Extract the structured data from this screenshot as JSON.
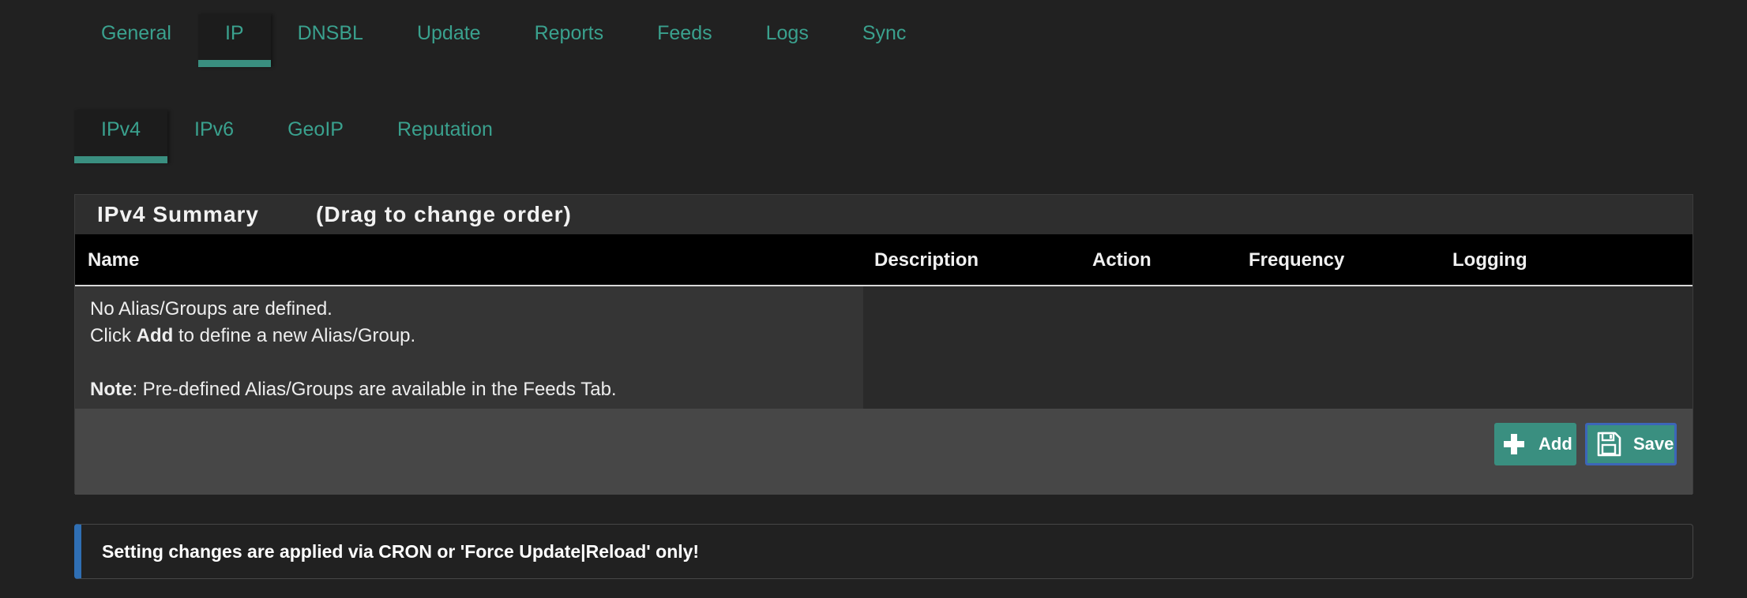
{
  "main_tabs": [
    "General",
    "IP",
    "DNSBL",
    "Update",
    "Reports",
    "Feeds",
    "Logs",
    "Sync"
  ],
  "sub_tabs": [
    "IPv4",
    "IPv6",
    "GeoIP",
    "Reputation"
  ],
  "panel": {
    "title": "IPv4 Summary",
    "subtitle": "(Drag to change order)"
  },
  "table": {
    "columns": [
      "Name",
      "Description",
      "Action",
      "Frequency",
      "Logging"
    ],
    "empty": {
      "line1": "No Alias/Groups are defined.",
      "line2_prefix": "Click ",
      "line2_bold": "Add",
      "line2_suffix": " to define a new Alias/Group.",
      "note_bold": "Note",
      "note_text": ": Pre-defined Alias/Groups are available in the Feeds Tab."
    }
  },
  "buttons": {
    "add": "Add",
    "save": "Save"
  },
  "alert": "Setting changes are applied via CRON or 'Force Update|Reload' only!",
  "colors": {
    "accent": "#3a8f80",
    "tab_text": "#3aa18e",
    "alert_border": "#2f6fb4"
  }
}
